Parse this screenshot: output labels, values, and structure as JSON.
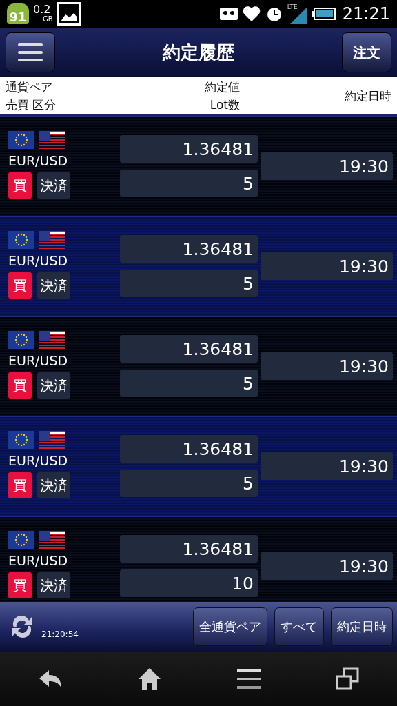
{
  "status_bar": {
    "badge": "91",
    "memory": "0.2",
    "memory_unit": "GB",
    "network": "LTE",
    "time": "21:21"
  },
  "header": {
    "title": "約定履歴",
    "action": "注文"
  },
  "columns": {
    "pair": "通貨ペア",
    "side": "売買 区分",
    "price": "約定値",
    "lots": "Lot数",
    "time": "約定日時"
  },
  "rows": [
    {
      "pair": "EUR/USD",
      "side": "買",
      "type": "決済",
      "price": "1.36481",
      "lots": "5",
      "time": "19:30"
    },
    {
      "pair": "EUR/USD",
      "side": "買",
      "type": "決済",
      "price": "1.36481",
      "lots": "5",
      "time": "19:30"
    },
    {
      "pair": "EUR/USD",
      "side": "買",
      "type": "決済",
      "price": "1.36481",
      "lots": "5",
      "time": "19:30"
    },
    {
      "pair": "EUR/USD",
      "side": "買",
      "type": "決済",
      "price": "1.36481",
      "lots": "5",
      "time": "19:30"
    },
    {
      "pair": "EUR/USD",
      "side": "買",
      "type": "決済",
      "price": "1.36481",
      "lots": "10",
      "time": "19:30"
    }
  ],
  "footer": {
    "updated": "21:20:54",
    "buttons": [
      "全通貨ペア",
      "すべて",
      "約定日時"
    ]
  }
}
